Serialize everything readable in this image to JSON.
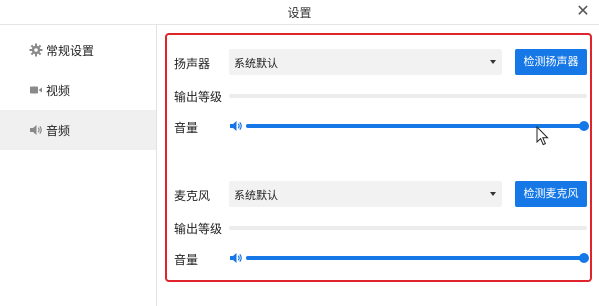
{
  "window": {
    "title": "设置",
    "close_glyph": "✕"
  },
  "sidebar": {
    "items": [
      {
        "label": "常规设置",
        "icon": "gear-icon",
        "active": false
      },
      {
        "label": "视频",
        "icon": "video-camera-icon",
        "active": false
      },
      {
        "label": "音频",
        "icon": "speaker-icon",
        "active": true
      }
    ]
  },
  "audio": {
    "speaker": {
      "label": "扬声器",
      "device": "系统默认",
      "test_button": "检测扬声器",
      "output_level_label": "输出等级",
      "output_level": 0,
      "volume_label": "音量",
      "volume": 100
    },
    "microphone": {
      "label": "麦克风",
      "device": "系统默认",
      "test_button": "检测麦克风",
      "input_level_label": "输出等级",
      "input_level": 0,
      "volume_label": "音量",
      "volume": 100
    }
  },
  "colors": {
    "accent": "#1677e6",
    "highlight_border": "#e0242b"
  }
}
